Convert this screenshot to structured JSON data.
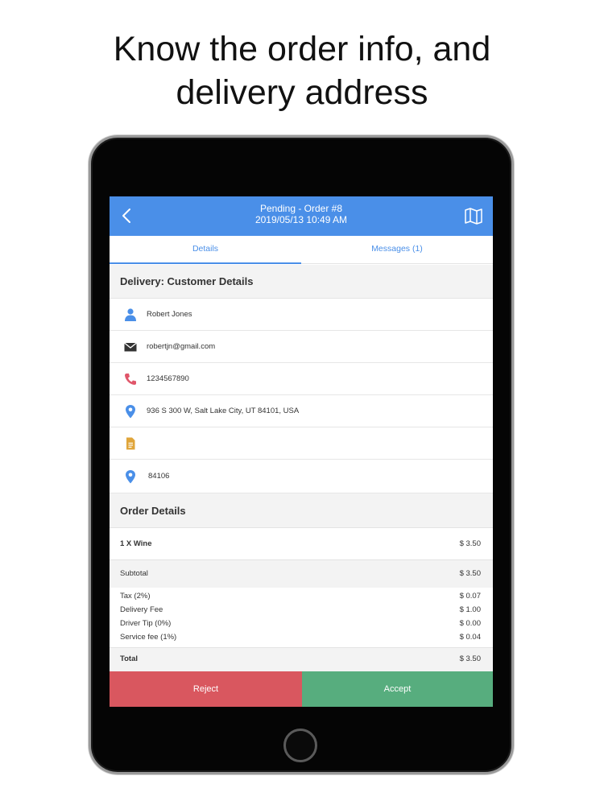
{
  "headline": {
    "line1": "Know the order info, and",
    "line2": "delivery address"
  },
  "header": {
    "title": "Pending - Order #8",
    "subtitle": "2019/05/13 10:49 AM"
  },
  "tabs": [
    {
      "label": "Details",
      "active": true
    },
    {
      "label": "Messages (1)",
      "active": false
    }
  ],
  "customer_section": {
    "title": "Delivery: Customer Details",
    "name": "Robert Jones",
    "email": "robertjn@gmail.com",
    "phone": "1234567890",
    "address": "936 S 300 W, Salt Lake City, UT 84101, USA",
    "note": "",
    "zip": "84106"
  },
  "order_section": {
    "title": "Order Details",
    "items": [
      {
        "label": "1 X Wine",
        "value": "$ 3.50"
      }
    ],
    "subtotal": {
      "label": "Subtotal",
      "value": "$ 3.50"
    },
    "fees": [
      {
        "label": "Tax (2%)",
        "value": "$ 0.07"
      },
      {
        "label": "Delivery Fee",
        "value": "$ 1.00"
      },
      {
        "label": "Driver Tip (0%)",
        "value": "$ 0.00"
      },
      {
        "label": "Service fee (1%)",
        "value": "$ 0.04"
      }
    ],
    "total": {
      "label": "Total",
      "value": "$ 3.50"
    }
  },
  "actions": {
    "reject_label": "Reject",
    "accept_label": "Accept"
  },
  "colors": {
    "primary": "#4a8fe8",
    "reject": "#d9575f",
    "accept": "#57ad7e",
    "person_icon": "#4a8fe8",
    "phone_icon": "#e0566a",
    "location_icon": "#4a8fe8",
    "note_icon": "#e0a53a"
  },
  "icons": [
    "back-chevron-icon",
    "map-icon",
    "person-icon",
    "mail-icon",
    "phone-icon",
    "location-pin-icon",
    "note-icon"
  ]
}
